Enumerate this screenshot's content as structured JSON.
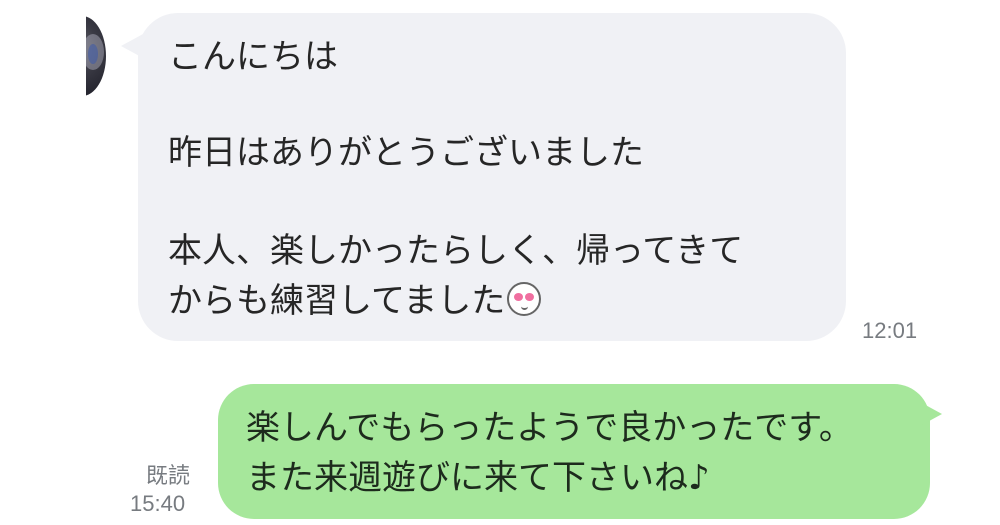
{
  "incoming": {
    "lines": [
      "こんにちは",
      "昨日はありがとうございました",
      "本人、楽しかったらしく、帰ってきて",
      "からも練習してました"
    ],
    "emoji_icon": "heart-eyes-emoji-icon",
    "time": "12:01",
    "bubble_color": "#f0f1f5"
  },
  "outgoing": {
    "lines": [
      "楽しんでもらったようで良かったです。",
      "また来週遊びに来て下さいね♪"
    ],
    "read_label": "既読",
    "time": "15:40",
    "bubble_color": "#a6e79b"
  }
}
